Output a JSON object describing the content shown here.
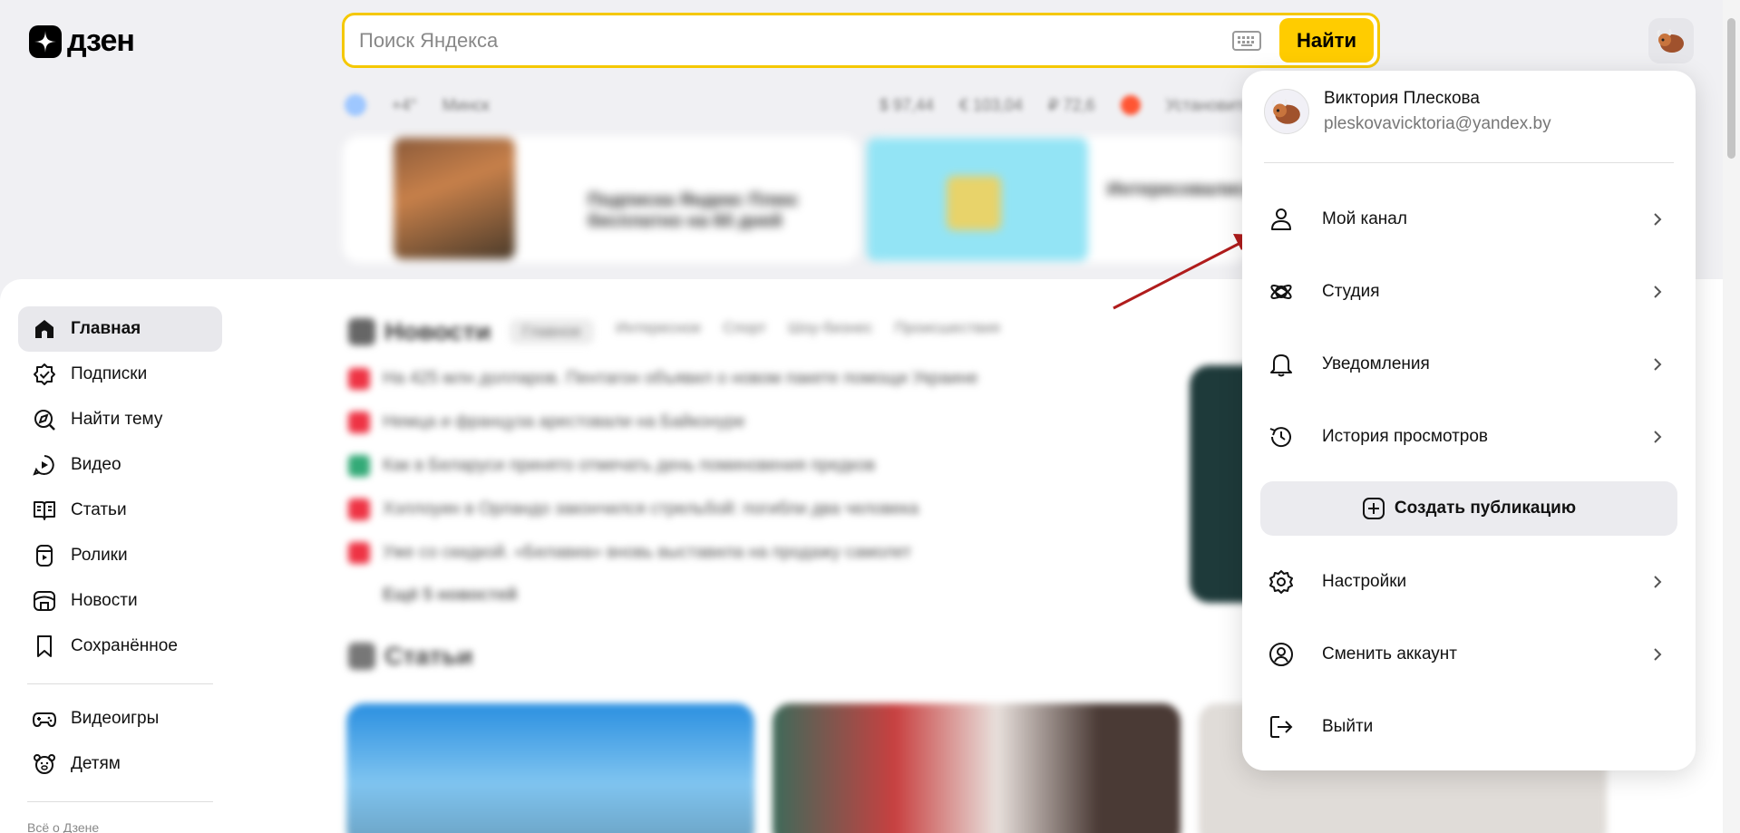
{
  "logo": {
    "text": "дзен"
  },
  "search": {
    "placeholder": "Поиск Яндекса",
    "button": "Найти"
  },
  "infostrip": {
    "temp": "+4°",
    "city": "Минск",
    "usd": "$ 97,44",
    "eur": "€ 103,04",
    "rub": "₽ 72,6",
    "install": "Установить"
  },
  "sidebar": {
    "items": [
      {
        "label": "Главная"
      },
      {
        "label": "Подписки"
      },
      {
        "label": "Найти тему"
      },
      {
        "label": "Видео"
      },
      {
        "label": "Статьи"
      },
      {
        "label": "Ролики"
      },
      {
        "label": "Новости"
      },
      {
        "label": "Сохранённое"
      },
      {
        "label": "Видеоигры"
      },
      {
        "label": "Детям"
      }
    ],
    "about": "Всё о Дзене"
  },
  "news": {
    "title": "Новости",
    "chips": [
      "Главное",
      "Интересное",
      "Спорт",
      "Шоу-бизнес",
      "Происшествия"
    ],
    "lines": [
      "На 425 млн долларов. Пентагон объявил о новом пакете помощи Украине",
      "Немца и француза арестовали на Байконуре",
      "Как в Беларуси принято отмечать день поминовения предков",
      "Хэллоуин в Орландо закончился стрельбой: погибли два человека",
      "Уже со скидкой. «Белавиа» вновь выставила на продажу самолет"
    ],
    "more": "Ещё 5 новостей"
  },
  "articles": {
    "title": "Статьи"
  },
  "promo": {
    "card1_title": "Подписка Яндекс Плюс бесплатно на 60 дней",
    "card2_title": "Интересовались Хантфлоу? Получите Месяц в подарок"
  },
  "menu": {
    "user_name": "Виктория Плескова",
    "user_email": "pleskovavicktoria@yandex.by",
    "items": [
      {
        "label": "Мой канал"
      },
      {
        "label": "Студия"
      },
      {
        "label": "Уведомления"
      },
      {
        "label": "История просмотров"
      },
      {
        "label": "Настройки"
      },
      {
        "label": "Сменить аккаунт"
      },
      {
        "label": "Выйти"
      }
    ],
    "create": "Создать публикацию"
  },
  "colors": {
    "accent": "#ffcc00",
    "arrow": "#b01c1c"
  }
}
